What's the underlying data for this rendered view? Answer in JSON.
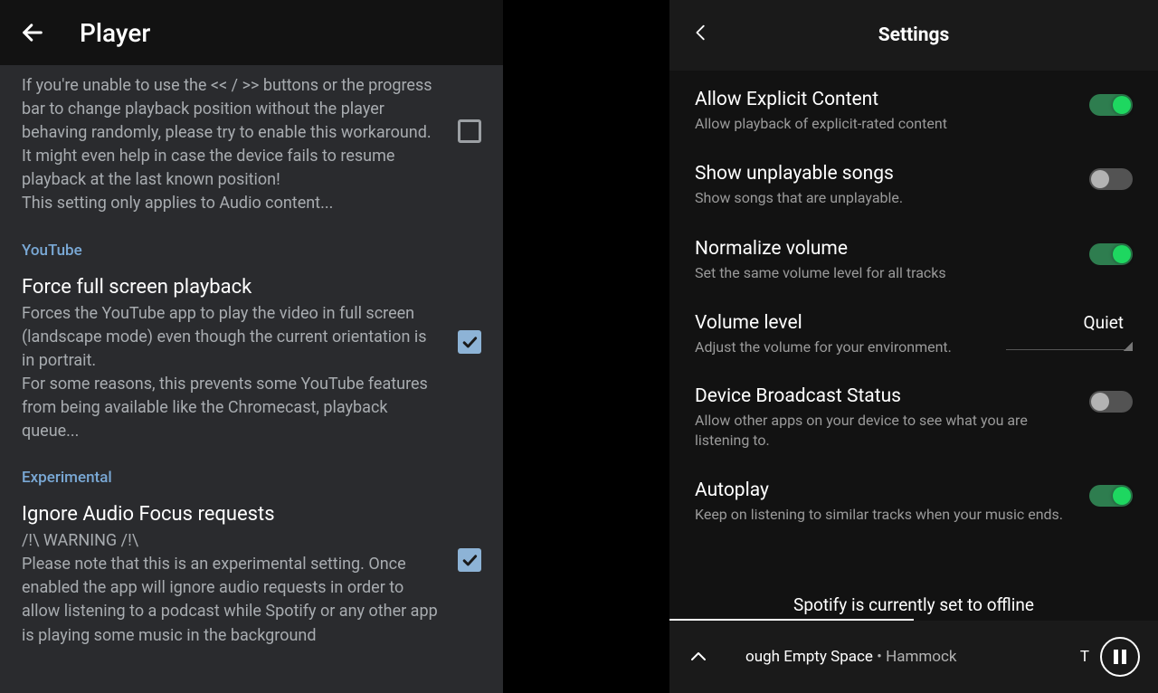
{
  "left": {
    "header_title": "Player",
    "top_setting_desc": "If you're unable to use the << / >> buttons or the progress bar to change playback position without the player behaving randomly, please try to enable this workaround.\nIt might even help in case the device fails to resume playback at the last known position!\nThis setting only applies to Audio content...",
    "section_youtube": "YouTube",
    "youtube_setting_title": "Force full screen playback",
    "youtube_setting_desc": "Forces the YouTube app to play the video in full screen (landscape mode) even though the current orientation is in portrait.\nFor some reasons, this prevents some YouTube features from being available like the Chromecast, playback queue...",
    "section_experimental": "Experimental",
    "exp_setting_title": "Ignore Audio Focus requests",
    "exp_setting_desc": "/!\\ WARNING /!\\\nPlease note that this is an experimental setting. Once enabled the app will ignore audio requests in order to allow listening to a podcast while Spotify or any other app is playing some music in the background"
  },
  "right": {
    "header_title": "Settings",
    "items": [
      {
        "title": "Allow Explicit Content",
        "desc": "Allow playback of explicit-rated content",
        "on": true
      },
      {
        "title": "Show unplayable songs",
        "desc": "Show songs that are unplayable.",
        "on": false
      },
      {
        "title": "Normalize volume",
        "desc": "Set the same volume level for all tracks",
        "on": true
      }
    ],
    "volume_title": "Volume level",
    "volume_desc": "Adjust the volume for your environment.",
    "volume_value": "Quiet",
    "items2": [
      {
        "title": "Device Broadcast Status",
        "desc": "Allow other apps on your device to see what you are listening to.",
        "on": false
      },
      {
        "title": "Autoplay",
        "desc": "Keep on listening to similar tracks when your music ends.",
        "on": true
      }
    ],
    "offline_text": "Spotify is currently set to offline",
    "now_playing_track": "ough Empty Space",
    "now_playing_sep": " • ",
    "now_playing_artist": "Hammock",
    "now_playing_right": "T"
  }
}
